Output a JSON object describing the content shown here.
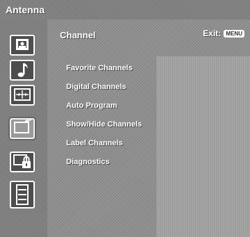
{
  "header": {
    "title": "Antenna"
  },
  "section": {
    "title": "Channel"
  },
  "exit": {
    "label": "Exit:",
    "key": "MENU"
  },
  "sidebar": {
    "icons": [
      {
        "name": "picture-icon"
      },
      {
        "name": "sound-icon"
      },
      {
        "name": "screen-icon"
      },
      {
        "name": "channel-icon"
      },
      {
        "name": "parental-lock-icon"
      },
      {
        "name": "setup-icon"
      }
    ],
    "selected": "channel-icon"
  },
  "menu": {
    "items": [
      {
        "label": "Favorite Channels"
      },
      {
        "label": "Digital Channels"
      },
      {
        "label": "Auto Program"
      },
      {
        "label": "Show/Hide Channels"
      },
      {
        "label": "Label Channels"
      },
      {
        "label": "Diagnostics"
      }
    ]
  },
  "colors": {
    "background": "#8f8f8f",
    "sidebar": "#7a7a7a",
    "text": "#ffffff",
    "panel": "#9c9c9c"
  }
}
